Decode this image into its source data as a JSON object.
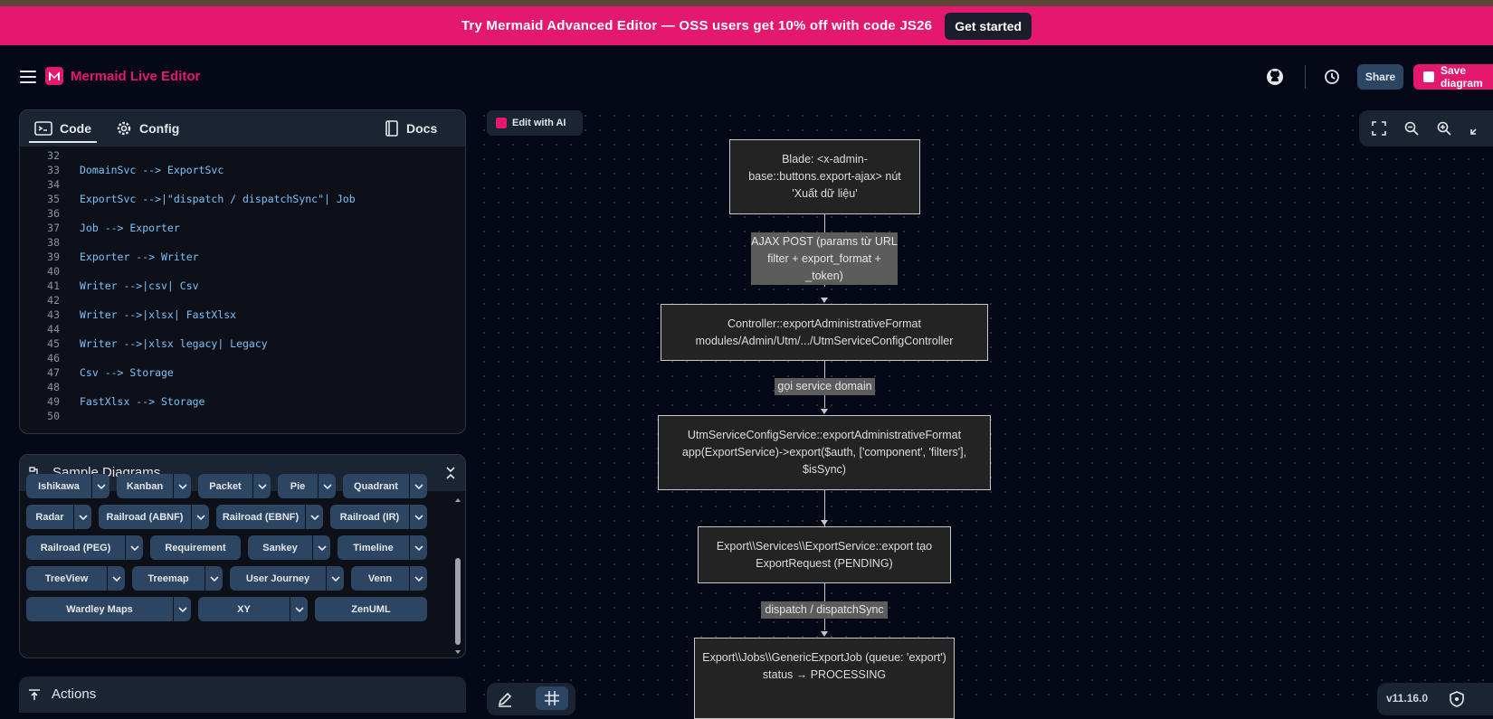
{
  "banner": {
    "text": "Try Mermaid Advanced Editor — OSS users get 10% off with code JS26",
    "cta": "Get started"
  },
  "header": {
    "title": "Mermaid Live Editor",
    "share": "Share",
    "save": "Save diagram"
  },
  "editor": {
    "tabs": {
      "code": "Code",
      "config": "Config",
      "docs": "Docs"
    },
    "lines": [
      {
        "n": "32",
        "t": ""
      },
      {
        "n": "33",
        "t": "DomainSvc --> ExportSvc"
      },
      {
        "n": "34",
        "t": ""
      },
      {
        "n": "35",
        "t": "ExportSvc -->|\"dispatch / dispatchSync\"| Job"
      },
      {
        "n": "36",
        "t": ""
      },
      {
        "n": "37",
        "t": "Job --> Exporter"
      },
      {
        "n": "38",
        "t": ""
      },
      {
        "n": "39",
        "t": "Exporter --> Writer"
      },
      {
        "n": "40",
        "t": ""
      },
      {
        "n": "41",
        "t": "Writer -->|csv| Csv"
      },
      {
        "n": "42",
        "t": ""
      },
      {
        "n": "43",
        "t": "Writer -->|xlsx| FastXlsx"
      },
      {
        "n": "44",
        "t": ""
      },
      {
        "n": "45",
        "t": "Writer -->|xlsx legacy| Legacy"
      },
      {
        "n": "46",
        "t": ""
      },
      {
        "n": "47",
        "t": "Csv --> Storage"
      },
      {
        "n": "48",
        "t": ""
      },
      {
        "n": "49",
        "t": "FastXlsx --> Storage"
      },
      {
        "n": "50",
        "t": ""
      }
    ]
  },
  "samples": {
    "title": "Sample Diagrams",
    "chips": [
      "Ishikawa",
      "Kanban",
      "Packet",
      "Pie",
      "Quadrant",
      "Radar",
      "Railroad (ABNF)",
      "Railroad (EBNF)",
      "Railroad (IR)",
      "Railroad (PEG)",
      "Requirement",
      "Sankey",
      "Timeline",
      "TreeView",
      "Treemap",
      "User Journey",
      "Venn",
      "Wardley Maps",
      "XY",
      "ZenUML"
    ]
  },
  "actions": {
    "title": "Actions"
  },
  "canvas": {
    "ai_button": "Edit with AI",
    "version": "v11.16.0",
    "nodes": [
      "Blade: <x-admin-base::buttons.export-ajax> nút 'Xuất dữ liệu'",
      "Controller::exportAdministrativeFormat modules/Admin/Utm/.../UtmServiceConfigController",
      "UtmServiceConfigService::exportAdministrativeFormat app(ExportService)->export($auth, ['component', 'filters'], $isSync)",
      "Export\\\\Services\\\\ExportService::export tạo ExportRequest (PENDING)",
      "Export\\\\Jobs\\\\GenericExportJob (queue: 'export') status → PROCESSING"
    ],
    "edge_labels": [
      "AJAX POST (params từ URL filter + export_format + _token)",
      "gọi service domain",
      "dispatch / dispatchSync"
    ]
  },
  "colors": {
    "accent": "#e5186f",
    "panel": "#1b2433",
    "chip": "#2b4563"
  }
}
